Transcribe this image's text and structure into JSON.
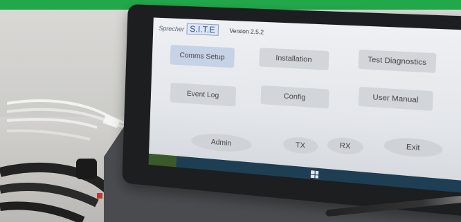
{
  "accent_color": "#22a84a",
  "app": {
    "brand_prefix": "Sprecher",
    "brand_logo": "S.I.T.E",
    "version": "Version 2.5.2"
  },
  "buttons": {
    "comms_setup": "Comms Setup",
    "installation": "Installation",
    "test_diagnostics": "Test Diagnostics",
    "event_log": "Event Log",
    "config": "Config",
    "user_manual": "User Manual",
    "admin": "Admin",
    "tx": "TX",
    "rx": "RX",
    "exit": "Exit"
  },
  "icons": {
    "windows_button": "windows-logo-icon"
  }
}
